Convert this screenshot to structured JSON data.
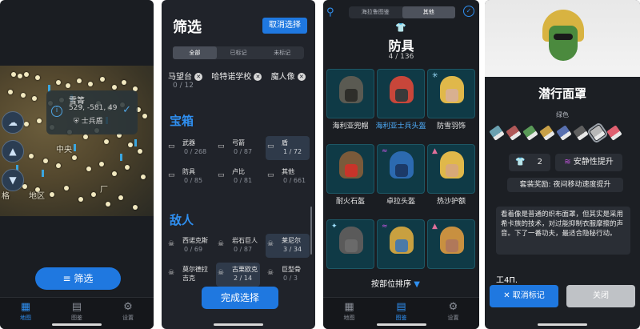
{
  "screen_map": {
    "map_labels": [
      "中央",
      "格",
      "地区",
      "厂"
    ],
    "popup": {
      "title": "雪箐",
      "coords": "529, -581, 49",
      "subtitle": "士兵盾"
    },
    "filter_button": "筛选",
    "tabs": [
      {
        "label": "地图",
        "icon": "map-icon",
        "active": true
      },
      {
        "label": "图鉴",
        "icon": "book-icon",
        "active": false
      },
      {
        "label": "设置",
        "icon": "gear-icon",
        "active": false
      }
    ]
  },
  "screen_filter": {
    "title": "筛选",
    "clear_button": "取消选择",
    "segments": [
      {
        "label": "全部",
        "active": true
      },
      {
        "label": "已标记",
        "active": false
      },
      {
        "label": "未标记",
        "active": false
      }
    ],
    "chips": [
      "马望台",
      "哈特诺学校",
      "魔人像"
    ],
    "chip_count": "0 / 12",
    "sections": [
      {
        "title": "宝箱",
        "items": [
          {
            "name": "武器",
            "value": "0 / 268",
            "selected": false
          },
          {
            "name": "弓箭",
            "value": "0 / 87",
            "selected": false
          },
          {
            "name": "盾",
            "value": "1 / 72",
            "selected": true
          },
          {
            "name": "防具",
            "value": "0 / 85",
            "selected": false
          },
          {
            "name": "卢比",
            "value": "0 / 81",
            "selected": false
          },
          {
            "name": "其他",
            "value": "0 / 661",
            "selected": false
          }
        ]
      },
      {
        "title": "敌人",
        "items": [
          {
            "name": "西诺克斯",
            "value": "0 / 69",
            "selected": false
          },
          {
            "name": "岩石巨人",
            "value": "0 / 87",
            "selected": false
          },
          {
            "name": "莱尼尔",
            "value": "3 / 34",
            "selected": true
          },
          {
            "name": "莫尔德拉吉克",
            "value": "",
            "selected": false
          },
          {
            "name": "古栗欧克",
            "value": "2 / 14",
            "selected": true
          },
          {
            "name": "巨型骨",
            "value": "0 / 3",
            "selected": false
          }
        ]
      }
    ],
    "done_button": "完成选择"
  },
  "screen_armor": {
    "segments": [
      {
        "label": "海拉鲁图鉴",
        "active": false
      },
      {
        "label": "其他",
        "active": true
      }
    ],
    "category": "防具",
    "count": "4 / 136",
    "items": [
      {
        "name": "海利亚兜帽",
        "highlight": false,
        "badge": "",
        "helm": "#5a5a52",
        "face": "#2e2e2a"
      },
      {
        "name": "海利亚士兵头盔",
        "highlight": true,
        "badge": "",
        "helm": "#c8463a",
        "face": "#3a3a3a"
      },
      {
        "name": "防雪羽饰",
        "highlight": false,
        "badge": "✳",
        "helm": "#e0b84a",
        "face": "#d8b090"
      },
      {
        "name": "耐火石盔",
        "highlight": false,
        "badge": "",
        "helm": "#7a5a3a",
        "face": "#c8342a"
      },
      {
        "name": "卓拉头盔",
        "highlight": false,
        "badge": "≈",
        "helm": "#2c6ab0",
        "face": "#1c3a68"
      },
      {
        "name": "热沙护额",
        "highlight": false,
        "badge": "▲",
        "helm": "#e0b84a",
        "face": "#d8a878"
      },
      {
        "name": "",
        "highlight": false,
        "badge": "✦",
        "helm": "#5a5a5a",
        "face": "#6a6a6a"
      },
      {
        "name": "",
        "highlight": false,
        "badge": "≈",
        "helm": "#c8a040",
        "face": "#4a7aa8"
      },
      {
        "name": "",
        "highlight": false,
        "badge": "▲",
        "helm": "#c89040",
        "face": "#b0785a"
      }
    ],
    "sort_label": "按部位排序",
    "tabs": [
      {
        "label": "地图",
        "icon": "map-icon",
        "active": false
      },
      {
        "label": "图鉴",
        "icon": "book-icon",
        "active": true
      },
      {
        "label": "设置",
        "icon": "gear-icon",
        "active": false
      }
    ]
  },
  "screen_detail": {
    "item_name": "潜行面罩",
    "color_label": "绿色",
    "dyes": [
      "#6aa0b0",
      "#b05858",
      "#5a9a58",
      "#c8a048",
      "#5870b0",
      "#606060",
      "#b8b8b8",
      "#e06070"
    ],
    "defense": "2",
    "buff": "安静性提升",
    "set_bonus": "套装奖励: 夜间移动速度提升",
    "description": "看着像是普通的织布面罩，但其实是采用希卡族的技术，对过能抑制衣服摩擦的声音。下了一番功夫，最适合隐秘行动。",
    "truncated_label": "工4Π.",
    "unmark_button": "取消标记",
    "close_button": "关闭"
  }
}
